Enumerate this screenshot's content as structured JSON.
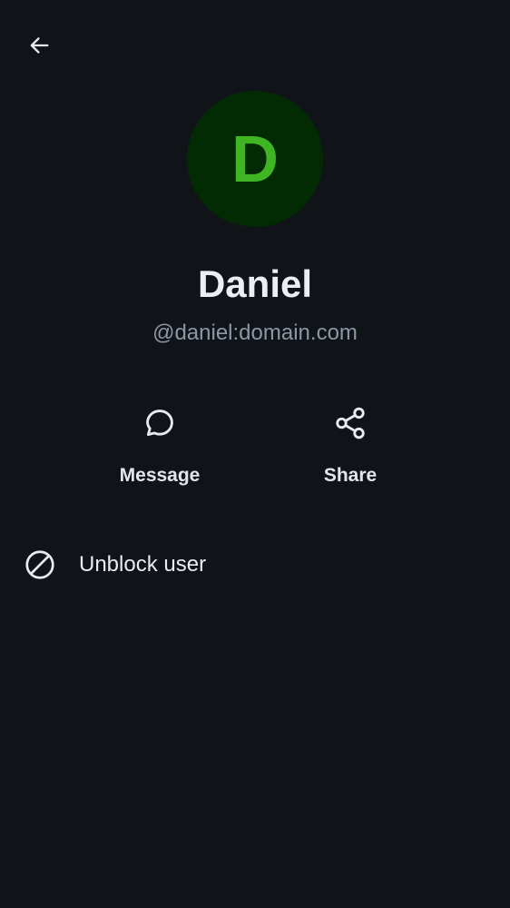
{
  "header": {
    "back_icon": "arrow-left-icon"
  },
  "profile": {
    "avatar_letter": "D",
    "avatar_bg_color": "#022b03",
    "avatar_letter_color": "#3fb524",
    "display_name": "Daniel",
    "user_id": "@daniel:domain.com"
  },
  "actions": [
    {
      "label": "Message",
      "icon": "chat-bubble-icon"
    },
    {
      "label": "Share",
      "icon": "share-icon"
    }
  ],
  "options": {
    "unblock_label": "Unblock user",
    "unblock_icon": "block-icon"
  },
  "colors": {
    "background": "#101318",
    "primary_text": "#ebeef2",
    "secondary_text": "#8d97a5"
  }
}
